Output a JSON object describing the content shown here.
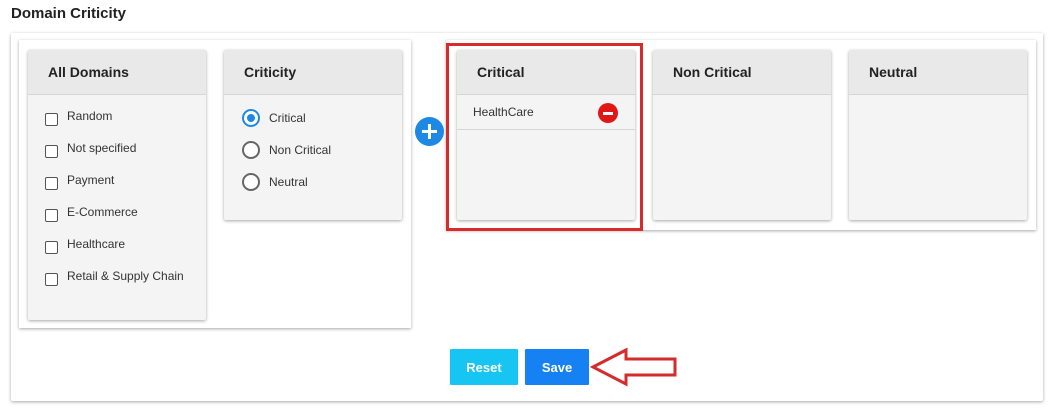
{
  "page": {
    "title": "Domain Criticity"
  },
  "all_domains": {
    "header": "All Domains",
    "items": [
      {
        "label": "Random",
        "checked": false
      },
      {
        "label": "Not specified",
        "checked": false
      },
      {
        "label": "Payment",
        "checked": false
      },
      {
        "label": "E-Commerce",
        "checked": false
      },
      {
        "label": "Healthcare",
        "checked": false
      },
      {
        "label": "Retail & Supply Chain",
        "checked": false
      }
    ]
  },
  "criticity": {
    "header": "Criticity",
    "options": [
      {
        "label": "Critical",
        "selected": true
      },
      {
        "label": "Non Critical",
        "selected": false
      },
      {
        "label": "Neutral",
        "selected": false
      }
    ]
  },
  "add_button": {
    "icon": "plus-icon"
  },
  "critical_panel": {
    "header": "Critical",
    "items": [
      {
        "label": "HealthCare",
        "icon": "minus-circle-icon"
      }
    ]
  },
  "non_critical_panel": {
    "header": "Non Critical"
  },
  "neutral_panel": {
    "header": "Neutral"
  },
  "actions": {
    "reset_label": "Reset",
    "save_label": "Save"
  },
  "colors": {
    "accent_blue": "#1e88e5",
    "reset_button": "#17c5f3",
    "save_button": "#1681f2",
    "remove_red": "#e01717",
    "annotation_red": "#d62b2b"
  }
}
